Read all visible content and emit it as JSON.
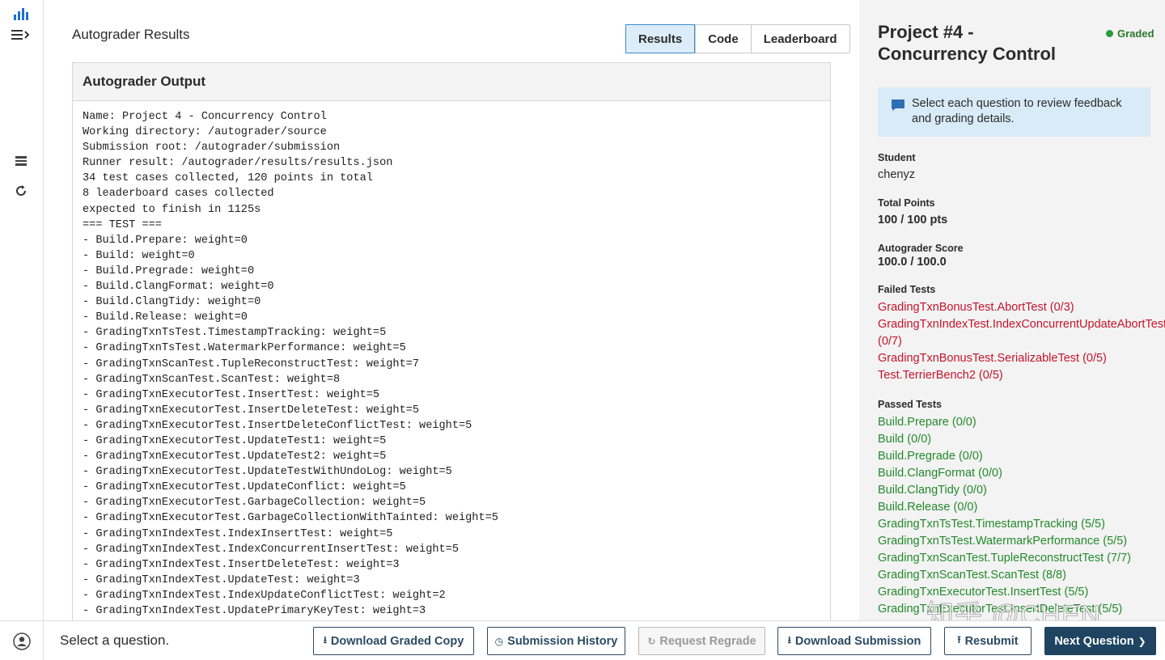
{
  "main": {
    "title": "Autograder Results",
    "tabs": [
      {
        "label": "Results",
        "active": true
      },
      {
        "label": "Code",
        "active": false
      },
      {
        "label": "Leaderboard",
        "active": false
      }
    ],
    "panel_title": "Autograder Output",
    "output_lines": [
      "Name: Project 4 - Concurrency Control",
      "Working directory: /autograder/source",
      "Submission root: /autograder/submission",
      "Runner result: /autograder/results/results.json",
      "34 test cases collected, 120 points in total",
      "8 leaderboard cases collected",
      "expected to finish in 1125s",
      "=== TEST ===",
      "- Build.Prepare: weight=0",
      "- Build: weight=0",
      "- Build.Pregrade: weight=0",
      "- Build.ClangFormat: weight=0",
      "- Build.ClangTidy: weight=0",
      "- Build.Release: weight=0",
      "- GradingTxnTsTest.TimestampTracking: weight=5",
      "- GradingTxnTsTest.WatermarkPerformance: weight=5",
      "- GradingTxnScanTest.TupleReconstructTest: weight=7",
      "- GradingTxnScanTest.ScanTest: weight=8",
      "- GradingTxnExecutorTest.InsertTest: weight=5",
      "- GradingTxnExecutorTest.InsertDeleteTest: weight=5",
      "- GradingTxnExecutorTest.InsertDeleteConflictTest: weight=5",
      "- GradingTxnExecutorTest.UpdateTest1: weight=5",
      "- GradingTxnExecutorTest.UpdateTest2: weight=5",
      "- GradingTxnExecutorTest.UpdateTestWithUndoLog: weight=5",
      "- GradingTxnExecutorTest.UpdateConflict: weight=5",
      "- GradingTxnExecutorTest.GarbageCollection: weight=5",
      "- GradingTxnExecutorTest.GarbageCollectionWithTainted: weight=5",
      "- GradingTxnIndexTest.IndexInsertTest: weight=5",
      "- GradingTxnIndexTest.IndexConcurrentInsertTest: weight=5",
      "- GradingTxnIndexTest.InsertDeleteTest: weight=3",
      "- GradingTxnIndexTest.UpdateTest: weight=3",
      "- GradingTxnIndexTest.IndexUpdateConflictTest: weight=2",
      "- GradingTxnIndexTest.UpdatePrimaryKeyTest: weight=3"
    ]
  },
  "side": {
    "title": "Project #4 - Concurrency Control",
    "status": "Graded",
    "notice": "Select each question to review feedback and grading details.",
    "student_label": "Student",
    "student": "chenyz",
    "total_points_label": "Total Points",
    "total_points": "100 / 100 pts",
    "autograder_label": "Autograder Score",
    "autograder_score": "100.0 / 100.0",
    "failed_label": "Failed Tests",
    "failed": [
      "GradingTxnBonusTest.AbortTest (0/3)",
      "GradingTxnIndexTest.IndexConcurrentUpdateAbortTest (0/7)",
      "GradingTxnBonusTest.SerializableTest (0/5)",
      "Test.TerrierBench2 (0/5)"
    ],
    "passed_label": "Passed Tests",
    "passed": [
      "Build.Prepare (0/0)",
      "Build (0/0)",
      "Build.Pregrade (0/0)",
      "Build.ClangFormat (0/0)",
      "Build.ClangTidy (0/0)",
      "Build.Release (0/0)",
      "GradingTxnTsTest.TimestampTracking (5/5)",
      "GradingTxnTsTest.WatermarkPerformance (5/5)",
      "GradingTxnScanTest.TupleReconstructTest (7/7)",
      "GradingTxnScanTest.ScanTest (8/8)",
      "GradingTxnExecutorTest.InsertTest (5/5)",
      "GradingTxnExecutorTest.InsertDeleteTest (5/5)"
    ]
  },
  "footer": {
    "status": "Select a question.",
    "buttons": {
      "download_graded": "Download Graded Copy",
      "history": "Submission History",
      "regrade": "Request Regrade",
      "download_submission": "Download Submission",
      "resubmit": "Resubmit",
      "next": "Next Question"
    }
  },
  "watermark": "知乎 @CHEN",
  "colors": {
    "accent": "#1e4461",
    "tab_active_bg": "#dcedf9",
    "failed": "#c4142b",
    "passed": "#238a2b",
    "notice_bg": "#d9ebf7"
  }
}
